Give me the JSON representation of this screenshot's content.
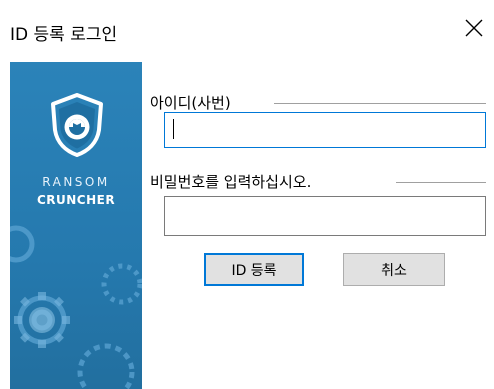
{
  "window": {
    "title": "ID 등록 로그인"
  },
  "sidebar": {
    "brand_line1": "RANSOM",
    "brand_line2": "CRUNCHER"
  },
  "form": {
    "id_label": "아이디(사번)",
    "id_value": "",
    "password_label": "비밀번호를 입력하십시오.",
    "password_value": ""
  },
  "buttons": {
    "register": "ID 등록",
    "cancel": "취소"
  },
  "colors": {
    "sidebar": "#2b83b9",
    "focus": "#0078d7",
    "button_face": "#e1e1e1"
  },
  "icons": {
    "close": "close-icon",
    "logo": "shield-logo-icon",
    "decor": "gear-icon"
  }
}
